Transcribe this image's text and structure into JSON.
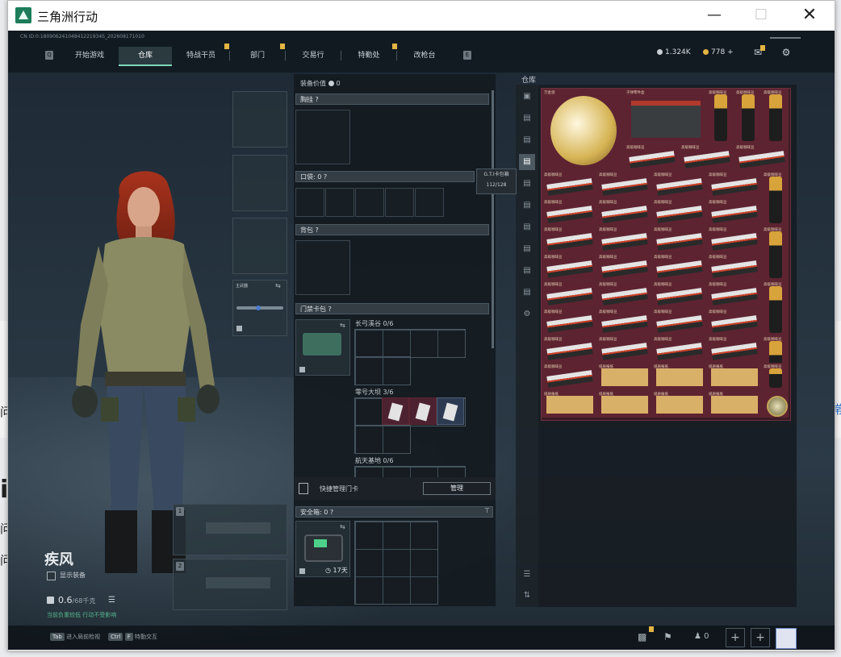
{
  "window": {
    "title": "三角洲行动"
  },
  "background_page": {
    "right_text": "常",
    "left_frag1": "问",
    "left_frag2": "i",
    "left_frag3": "问",
    "left_frag4": "问"
  },
  "topbar": {
    "cn_id": "CN ID:0:18090624104841221934S_202608171010",
    "tabs": [
      "开始游戏",
      "仓库",
      "特战干员",
      "部门",
      "交易行",
      "特勤处",
      "改枪台"
    ],
    "active_tab": "仓库",
    "left_key": "Q",
    "right_key": "E",
    "currency1": "1.324K",
    "currency2": "778",
    "currency_plus": "+"
  },
  "operator": {
    "name": "疾风",
    "show_gear": "显示装备",
    "weight": "0.6",
    "weight_max": "/68千克",
    "hint": "当前负重较低 行动不受影响"
  },
  "equipment": {
    "value_label": "装备价值",
    "value": "0",
    "chest_rig": "胸挂",
    "pockets": "口袋:",
    "pockets_val": "0",
    "backpack": "背包",
    "keycard_bag": "门禁卡包",
    "primary_weapon_label": "主武器",
    "map1": "长弓溪谷",
    "map1_count": "0/6",
    "map2": "零号大坝",
    "map2_count": "3/6",
    "map3": "航天基地",
    "map3_count": "0/6",
    "quick_manage": "快捷管理门卡",
    "manage_btn": "管理",
    "safe_box": "安全箱:",
    "safe_val": "0",
    "safe_days": "17天",
    "tooltip_title": "G.T.I卡包箱",
    "tooltip_val": "112/128",
    "slot_key1": "1",
    "slot_key2": "2",
    "qmark": "?"
  },
  "warehouse": {
    "title": "仓库",
    "item_label_egg": "万金泪",
    "item_label_server": "子弹零件盒",
    "item_label_coffee": "高级咖啡豆",
    "item_label_cigar": "高级咖啡豆",
    "item_label_paper": "纸质报纸",
    "item_label_compass": ""
  },
  "bottombar": {
    "tab_key": "Tab",
    "tab_text": "进入局前检视",
    "ctrl_key": "Ctrl",
    "ctrl_key2": "F",
    "ctrl_text": "特勤交互",
    "friends": "0"
  },
  "colors": {
    "accent": "#7fd6b6",
    "item_bg": "#5e2331",
    "gold": "#e3b542"
  }
}
